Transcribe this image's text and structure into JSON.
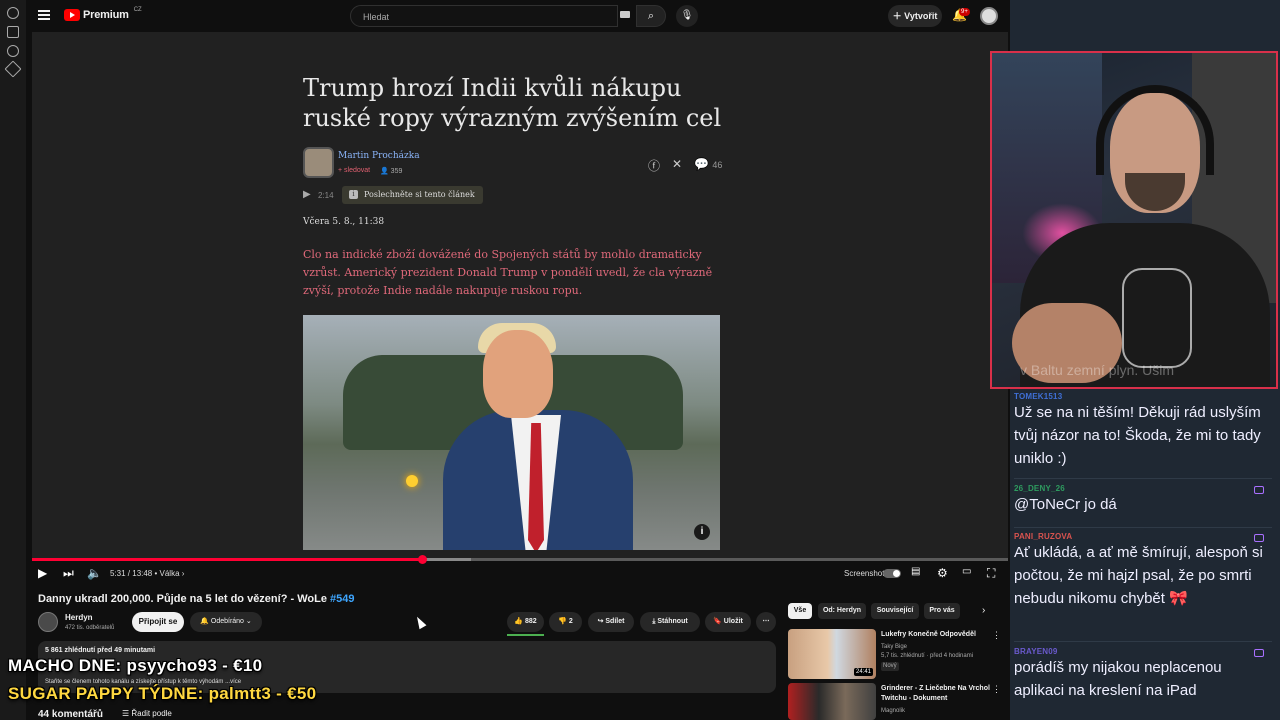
{
  "topbar": {
    "brand": "Premium",
    "brand_sup": "CZ",
    "search_placeholder": "Hledat",
    "create_label": "Vytvořit",
    "notif_count": "9+"
  },
  "article": {
    "title": "Trump hrozí Indii kvůli nákupu ruské ropy výrazným zvýšením cel",
    "author": "Martin Procházka",
    "follow": "+ sledovat",
    "followers": "359",
    "comments": "46",
    "listen_time": "2:14",
    "listen_label": "Poslechněte si tento článek",
    "date": "Včera 5. 8., 11:38",
    "lead": "Clo na indické zboží dovážené do Spojených států by mohlo dramaticky vzrůst. Americký prezident Donald Trump v pondělí uvedl, že cla výrazně zvýší, protože Indie nadále nakupuje ruskou ropu."
  },
  "player": {
    "time": "5:31 / 13:48",
    "chapter": "Válka",
    "played_fraction": 0.4,
    "buffered_fraction": 0.45,
    "screenshot_label": "Screenshot"
  },
  "video": {
    "title": "Danny ukradl 200,000. Půjde na 5 let do vězení? - WoLe",
    "episode": "#549",
    "channel": "Herdyn",
    "subs": "472 tis. odběratelů",
    "join": "Připojit se",
    "subscribed": "Odebíráno",
    "likes": "882",
    "dislikes": "2",
    "share": "Sdílet",
    "download": "Stáhnout",
    "save": "Uložit",
    "views": "5 861 zhlédnutí  před 49 minutami",
    "desc": "Staňte se členem tohoto kanálu a získejte přístup k těmto výhodám ...více",
    "comments": "44 komentářů",
    "sort": "Řadit podle"
  },
  "recs": {
    "tabs": [
      "Vše",
      "Od: Herdyn",
      "Související",
      "Pro vás"
    ],
    "items": [
      {
        "title": "Lukefry Konečně Odpověděl",
        "channel": "Taky Bige",
        "meta": "5,7 tis. zhlédnutí · před 4 hodinami",
        "badge": "Nový",
        "duration": "24:41"
      },
      {
        "title": "Grinderer - Z Liečebne Na Vrchol Twitchu - Dokument",
        "channel": "Magnolik",
        "meta": "",
        "badge": "",
        "duration": ""
      }
    ]
  },
  "overlays": {
    "line1": "MACHO DNE: psyycho93 - €10",
    "line2": "SUGAR PAPPY TÝDNE: palmtt3 - €50"
  },
  "cam": {
    "ghost_text": "v Baltu zemní plyn. Ušim"
  },
  "chat": [
    {
      "user": "TOMEK1513",
      "color": "#3f6fd6",
      "text": "Už se na ni těším! Děkuji rád uslyším tvůj názor na to! Škoda, že mi to tady uniklo :)"
    },
    {
      "user": "26_DENY_26",
      "color": "#2e9b5f",
      "text": "@ToNeCr jo dá"
    },
    {
      "user": "PANI_RUZOVA",
      "color": "#d9534f",
      "text": "Ať ukládá, a ať mě šmírují, alespoň si počtou, že mi hajzl psal, že po smrti nebudu nikomu chybět 🎀"
    },
    {
      "user": "BRAYEN09",
      "color": "#6a5acd",
      "text": "porádíš my nijakou neplacenou aplikaci na kreslení na iPad"
    }
  ]
}
